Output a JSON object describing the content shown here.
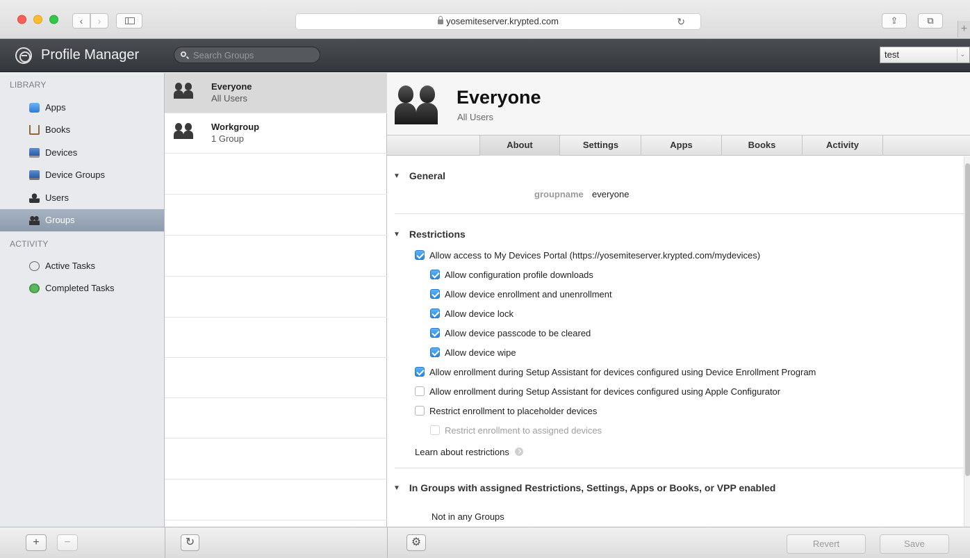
{
  "browser": {
    "url": "yosemiteserver.krypted.com",
    "back_glyph": "‹",
    "forward_glyph": "›",
    "reload_glyph": "↻",
    "share_glyph": "⇪",
    "tabs_glyph": "⧉",
    "newtab_glyph": "+"
  },
  "app": {
    "title": "Profile Manager",
    "search_placeholder": "Search Groups",
    "user_menu": "test",
    "user_menu_chevron": "⌄"
  },
  "sidebar": {
    "library_header": "LIBRARY",
    "library_items": [
      {
        "label": "Apps",
        "icon": "apps-icon"
      },
      {
        "label": "Books",
        "icon": "books-icon"
      },
      {
        "label": "Devices",
        "icon": "devices-icon"
      },
      {
        "label": "Device Groups",
        "icon": "device-groups-icon"
      },
      {
        "label": "Users",
        "icon": "users-icon"
      },
      {
        "label": "Groups",
        "icon": "groups-icon",
        "selected": true
      }
    ],
    "activity_header": "ACTIVITY",
    "activity_items": [
      {
        "label": "Active Tasks",
        "icon": "active-tasks-icon"
      },
      {
        "label": "Completed Tasks",
        "icon": "completed-tasks-icon"
      }
    ]
  },
  "groups_list": [
    {
      "title": "Everyone",
      "subtitle": "All Users",
      "selected": true
    },
    {
      "title": "Workgroup",
      "subtitle": "1 Group",
      "selected": false
    }
  ],
  "detail": {
    "title": "Everyone",
    "subtitle": "All Users",
    "tabs": [
      "About",
      "Settings",
      "Apps",
      "Books",
      "Activity"
    ],
    "active_tab": "About",
    "general": {
      "header": "General",
      "key": "groupname",
      "value": "everyone"
    },
    "restrictions": {
      "header": "Restrictions",
      "items": [
        {
          "label": "Allow access to My Devices Portal (https://yosemiteserver.krypted.com/mydevices)",
          "checked": true,
          "indent": 0,
          "enabled": true
        },
        {
          "label": "Allow configuration profile downloads",
          "checked": true,
          "indent": 1,
          "enabled": true
        },
        {
          "label": "Allow device enrollment and unenrollment",
          "checked": true,
          "indent": 1,
          "enabled": true
        },
        {
          "label": "Allow device lock",
          "checked": true,
          "indent": 1,
          "enabled": true
        },
        {
          "label": "Allow device passcode to be cleared",
          "checked": true,
          "indent": 1,
          "enabled": true
        },
        {
          "label": "Allow device wipe",
          "checked": true,
          "indent": 1,
          "enabled": true
        },
        {
          "label": "Allow enrollment during Setup Assistant for devices configured using Device Enrollment Program",
          "checked": true,
          "indent": 0,
          "enabled": true
        },
        {
          "label": "Allow enrollment during Setup Assistant for devices configured using Apple Configurator",
          "checked": false,
          "indent": 0,
          "enabled": true
        },
        {
          "label": "Restrict enrollment to placeholder devices",
          "checked": false,
          "indent": 0,
          "enabled": true
        },
        {
          "label": "Restrict enrollment to assigned devices",
          "checked": false,
          "indent": 1,
          "enabled": false
        }
      ],
      "learn_link": "Learn about restrictions"
    },
    "groups_section": {
      "header": "In Groups with assigned Restrictions, Settings, Apps or Books, or VPP enabled",
      "text": "Not in any Groups"
    }
  },
  "bottom": {
    "add_glyph": "+",
    "remove_glyph": "−",
    "refresh_glyph": "↻",
    "gear_glyph": "⚙",
    "revert_label": "Revert",
    "save_label": "Save"
  }
}
